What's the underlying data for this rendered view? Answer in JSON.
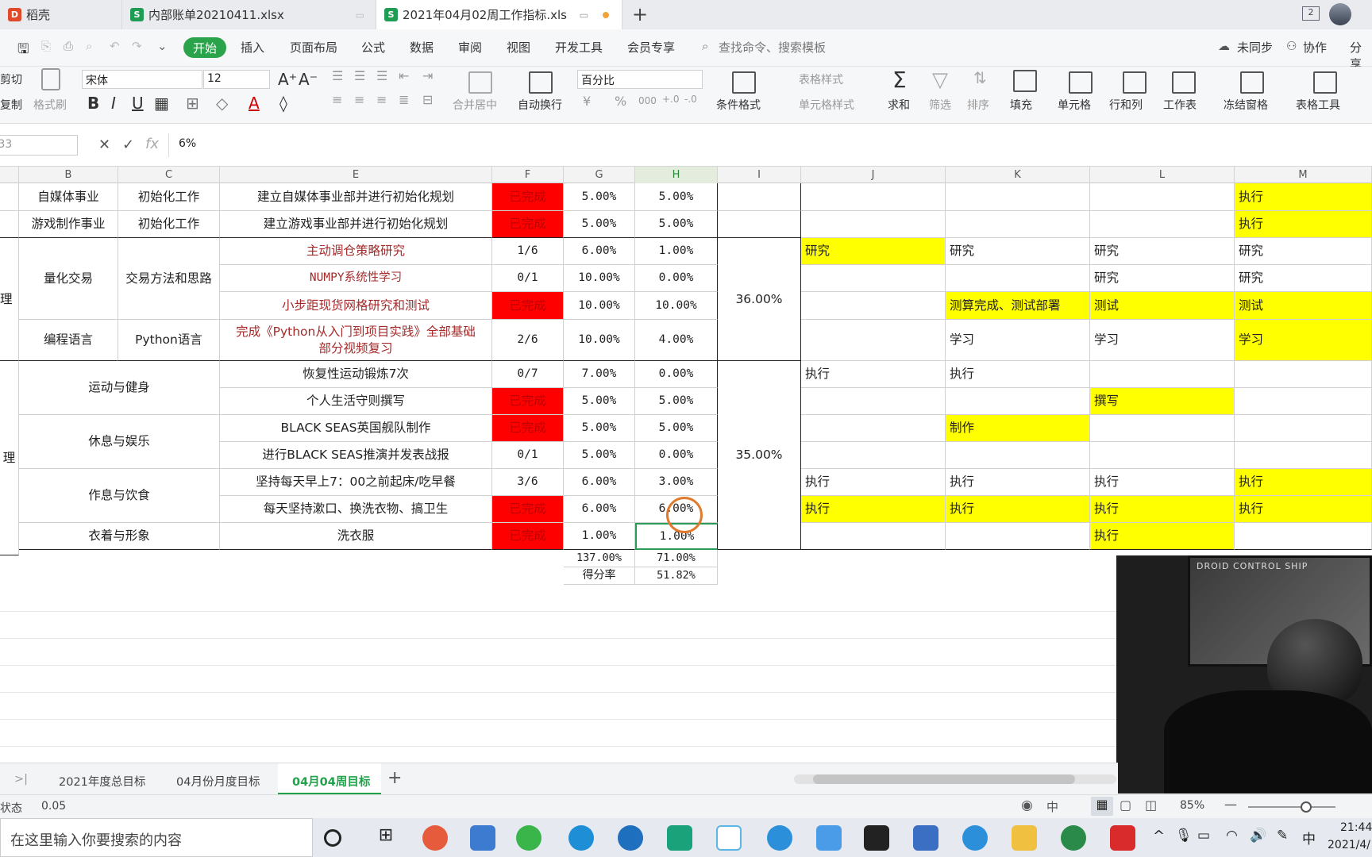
{
  "tabs": [
    {
      "label": "稻壳",
      "icon": "docer-icon"
    },
    {
      "label": "内部账单20210411.xlsx",
      "icon": "spreadsheet-icon"
    },
    {
      "label": "2021年04月02周工作指标.xls",
      "icon": "spreadsheet-icon"
    }
  ],
  "window": {
    "badge": "2"
  },
  "menu": {
    "start": "开始",
    "items": [
      "插入",
      "页面布局",
      "公式",
      "数据",
      "审阅",
      "视图",
      "开发工具",
      "会员专享"
    ],
    "search": "查找命令、搜索模板",
    "right": [
      "未同步",
      "协作",
      "分享"
    ]
  },
  "ribbon": {
    "cut": "剪切",
    "paste_copy": "复制",
    "format_painter": "格式刷",
    "font": "宋体",
    "size": "12",
    "number_format": "百分比",
    "merge": "合并居中",
    "wrap": "自动换行",
    "cond": "条件格式",
    "table_style": "表格样式",
    "cell_style": "单元格样式",
    "sum": "求和",
    "filter": "筛选",
    "sort": "排序",
    "fill": "填充",
    "cell": "单元格",
    "rowcol": "行和列",
    "sheet": "工作表",
    "freeze": "冻结窗格",
    "tools": "表格工具"
  },
  "formula": {
    "namebox": "H33",
    "value": "6%"
  },
  "columns": [
    "B",
    "C",
    "E",
    "F",
    "G",
    "H",
    "I",
    "J",
    "K",
    "L",
    "M"
  ],
  "rows": {
    "r1": {
      "b": "自媒体事业",
      "c": "初始化工作",
      "e": "建立自媒体事业部并进行初始化规划",
      "f": "已完成",
      "g": "5.00%",
      "h": "5.00%",
      "m": "执行"
    },
    "r2": {
      "b": "游戏制作事业",
      "c": "初始化工作",
      "e": "建立游戏事业部并进行初始化规划",
      "f": "已完成",
      "g": "5.00%",
      "h": "5.00%",
      "m": "执行"
    },
    "r3": {
      "e": "主动调仓策略研究",
      "f": "1/6",
      "g": "6.00%",
      "h": "1.00%",
      "j": "研究",
      "k": "研究",
      "l": "研究",
      "m": "研究"
    },
    "r4": {
      "e": "NUMPY系统性学习",
      "f": "0/1",
      "g": "10.00%",
      "h": "0.00%",
      "l": "研究",
      "m": "研究"
    },
    "r5": {
      "e": "小步距现货网格研究和测试",
      "f": "已完成",
      "g": "10.00%",
      "h": "10.00%",
      "k": "测算完成、测试部署",
      "l": "测试",
      "m": "测试"
    },
    "r6": {
      "b": "编程语言",
      "c": "Python语言",
      "e1": "完成《Python从入门到项目实践》全部基础",
      "e2": "部分视频复习",
      "f": "2/6",
      "g": "10.00%",
      "h": "4.00%",
      "k": "学习",
      "l": "学习",
      "m": "学习"
    },
    "group_quant": {
      "a": "理",
      "b": "量化交易",
      "c": "交易方法和思路",
      "i": "36.00%"
    },
    "r7": {
      "e": "恢复性运动锻炼7次",
      "f": "0/7",
      "g": "7.00%",
      "h": "0.00%",
      "j": "执行",
      "k": "执行"
    },
    "r8": {
      "e": "个人生活守则撰写",
      "f": "已完成",
      "g": "5.00%",
      "h": "5.00%",
      "l": "撰写"
    },
    "r9": {
      "e": "BLACK SEAS英国舰队制作",
      "f": "已完成",
      "g": "5.00%",
      "h": "5.00%",
      "k": "制作"
    },
    "r10": {
      "e": "进行BLACK SEAS推演并发表战报",
      "f": "0/1",
      "g": "5.00%",
      "h": "0.00%"
    },
    "r11": {
      "e": "坚持每天早上7：00之前起床/吃早餐",
      "f": "3/6",
      "g": "6.00%",
      "h": "3.00%",
      "j": "执行",
      "k": "执行",
      "l": "执行",
      "m": "执行"
    },
    "r12": {
      "e": "每天坚持漱口、换洗衣物、搞卫生",
      "f": "已完成",
      "g": "6.00%",
      "h": "6.00%",
      "j": "执行",
      "k": "执行",
      "l": "执行",
      "m": "执行"
    },
    "r13": {
      "b": "衣着与形象",
      "e": "洗衣服",
      "f": "已完成",
      "g": "1.00%",
      "h": "1.00%",
      "l": "执行"
    },
    "group_life": {
      "a": "理",
      "sport": "运动与健身",
      "rest": "休息与娱乐",
      "diet": "作息与饮食",
      "i": "35.00%"
    },
    "total": {
      "g": "137.00%",
      "h": "71.00%"
    },
    "score": {
      "label": "得分率",
      "h": "51.82%"
    }
  },
  "sheets": [
    "2021年度总目标",
    "04月份月度目标",
    "04月04周目标"
  ],
  "status": {
    "label": "状态",
    "value": "0.05",
    "zoom": "85%"
  },
  "taskbar": {
    "search": "在这里输入你要搜索的内容",
    "clock": "21:44",
    "date": "2021/4/",
    "ime": "中"
  },
  "webcam": {
    "poster_text": "DROID CONTROL SHIP"
  }
}
